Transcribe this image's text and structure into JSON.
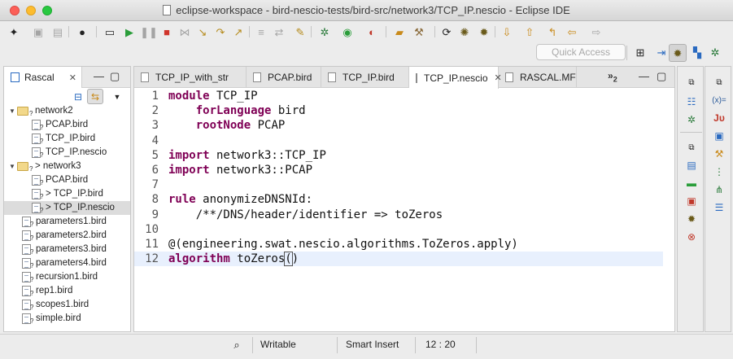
{
  "window": {
    "title": "eclipse-workspace - bird-nescio-tests/bird-src/network3/TCP_IP.nescio - Eclipse IDE"
  },
  "toolbar": {
    "quick_access_placeholder": "Quick Access",
    "icons": [
      "new-icon",
      "save-icon",
      "save-all-icon",
      "user-icon",
      "terminal-icon",
      "resume-icon",
      "suspend-icon",
      "terminate-icon",
      "disconnect-icon",
      "step-into-icon",
      "step-over-icon",
      "step-return-icon",
      "drop-frame-icon",
      "use-step-filters-icon",
      "debug-icon",
      "run-icon",
      "external-tools-icon",
      "open-folder-icon",
      "hammer-icon",
      "refresh-icon",
      "bug-icon",
      "beetle-icon",
      "next-annotation-icon",
      "previous-annotation-icon",
      "last-edit-icon",
      "back-icon",
      "forward-icon"
    ]
  },
  "left_panel": {
    "tab_label": "Rascal",
    "tree": [
      {
        "label": "network2",
        "kind": "folder",
        "depth": 0,
        "expanded": true,
        "prefix": "",
        "decorator": "?"
      },
      {
        "label": "PCAP.bird",
        "kind": "file",
        "depth": 1,
        "prefix": "",
        "decorator": "?"
      },
      {
        "label": "TCP_IP.bird",
        "kind": "file",
        "depth": 1,
        "prefix": "",
        "decorator": "?"
      },
      {
        "label": "TCP_IP.nescio",
        "kind": "file",
        "depth": 1,
        "prefix": "",
        "decorator": "?"
      },
      {
        "label": "network3",
        "kind": "folder",
        "depth": 0,
        "expanded": true,
        "prefix": "> ",
        "decorator": "?"
      },
      {
        "label": "PCAP.bird",
        "kind": "file",
        "depth": 1,
        "prefix": "",
        "decorator": "?"
      },
      {
        "label": "TCP_IP.bird",
        "kind": "file",
        "depth": 1,
        "prefix": "> ",
        "decorator": "?"
      },
      {
        "label": "TCP_IP.nescio",
        "kind": "file",
        "depth": 1,
        "prefix": "> ",
        "decorator": "?",
        "selected": true
      },
      {
        "label": "parameters1.bird",
        "kind": "file",
        "depth": 0,
        "prefix": "",
        "decorator": "?"
      },
      {
        "label": "parameters2.bird",
        "kind": "file",
        "depth": 0,
        "prefix": "",
        "decorator": "?"
      },
      {
        "label": "parameters3.bird",
        "kind": "file",
        "depth": 0,
        "prefix": "",
        "decorator": "?"
      },
      {
        "label": "parameters4.bird",
        "kind": "file",
        "depth": 0,
        "prefix": "",
        "decorator": "?"
      },
      {
        "label": "recursion1.bird",
        "kind": "file",
        "depth": 0,
        "prefix": "",
        "decorator": "?"
      },
      {
        "label": "rep1.bird",
        "kind": "file",
        "depth": 0,
        "prefix": "",
        "decorator": "?"
      },
      {
        "label": "scopes1.bird",
        "kind": "file",
        "depth": 0,
        "prefix": "",
        "decorator": "?"
      },
      {
        "label": "simple.bird",
        "kind": "file",
        "depth": 0,
        "prefix": "",
        "decorator": "?"
      }
    ]
  },
  "editor": {
    "tabs": [
      {
        "label": "TCP_IP_with_str",
        "active": false
      },
      {
        "label": "PCAP.bird",
        "active": false
      },
      {
        "label": "TCP_IP.bird",
        "active": false
      },
      {
        "label": "TCP_IP.nescio",
        "active": true
      },
      {
        "label": "RASCAL.MF",
        "active": false
      }
    ],
    "overflow_count": "2",
    "lines": [
      {
        "n": "1",
        "parts": [
          {
            "t": "module",
            "kw": true
          },
          {
            "t": " TCP_IP"
          }
        ]
      },
      {
        "n": "2",
        "parts": [
          {
            "t": "    "
          },
          {
            "t": "forLanguage",
            "kw": true
          },
          {
            "t": " bird"
          }
        ]
      },
      {
        "n": "3",
        "parts": [
          {
            "t": "    "
          },
          {
            "t": "rootNode",
            "kw": true
          },
          {
            "t": " PCAP"
          }
        ]
      },
      {
        "n": "4",
        "parts": []
      },
      {
        "n": "5",
        "parts": [
          {
            "t": "import",
            "kw": true
          },
          {
            "t": " network3::TCP_IP"
          }
        ]
      },
      {
        "n": "6",
        "parts": [
          {
            "t": "import",
            "kw": true
          },
          {
            "t": " network3::PCAP"
          }
        ]
      },
      {
        "n": "7",
        "parts": []
      },
      {
        "n": "8",
        "parts": [
          {
            "t": "rule",
            "kw": true
          },
          {
            "t": " anonymizeDNSNId:"
          }
        ]
      },
      {
        "n": "9",
        "parts": [
          {
            "t": "    /**/DNS/header/identifier => toZeros"
          }
        ]
      },
      {
        "n": "10",
        "parts": []
      },
      {
        "n": "11",
        "parts": [
          {
            "t": "@(engineering.swat.nescio.algorithms.ToZeros.apply)"
          }
        ]
      },
      {
        "n": "12",
        "parts": [
          {
            "t": "algorithm",
            "kw": true
          },
          {
            "t": " toZeros"
          },
          {
            "t": "(",
            "caret": true
          },
          {
            "t": ")"
          }
        ],
        "current": true
      }
    ]
  },
  "status": {
    "mode": "Writable",
    "insert": "Smart Insert",
    "position": "12 : 20"
  }
}
